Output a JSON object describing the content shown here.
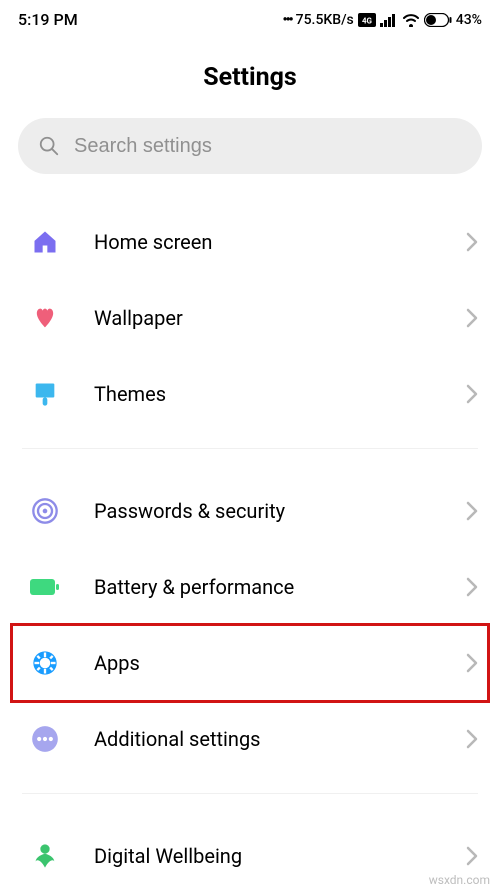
{
  "status": {
    "time": "5:19 PM",
    "speed": "75.5KB/s",
    "battery": "43%"
  },
  "title": "Settings",
  "search": {
    "placeholder": "Search settings"
  },
  "items": {
    "home": "Home screen",
    "wallpaper": "Wallpaper",
    "themes": "Themes",
    "passwords": "Passwords & security",
    "battery": "Battery & performance",
    "apps": "Apps",
    "additional": "Additional settings",
    "wellbeing": "Digital Wellbeing"
  },
  "colors": {
    "home": "#7b6ef0",
    "wallpaper": "#ef5f7a",
    "themes": "#3cb7ee",
    "passwords": "#8e8ce8",
    "battery": "#3ed97f",
    "apps": "#1a9dff",
    "additional": "#a6a6ee",
    "wellbeing": "#3bc46e"
  },
  "watermark": "wsxdn.com"
}
